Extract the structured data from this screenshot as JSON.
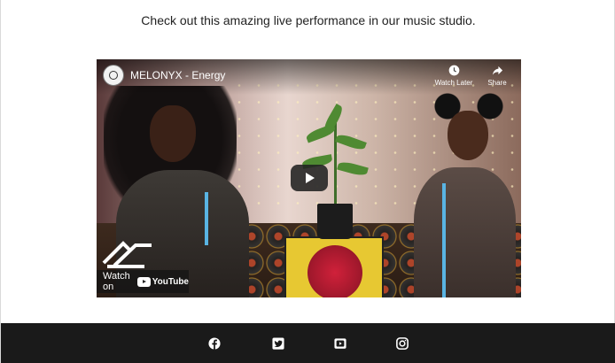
{
  "intro": {
    "text": "Check out this amazing live performance in our music studio."
  },
  "video": {
    "channel": "MELONYX",
    "title": "MELONYX - Energy",
    "actions": [
      {
        "label": "Watch Later",
        "icon": "clock-icon"
      },
      {
        "label": "Share",
        "icon": "share-icon"
      }
    ],
    "watch_on_label": "Watch on",
    "youtube_label": "YouTube",
    "play_icon": "play-icon"
  },
  "footer": {
    "background": "#1a1a1a",
    "social": [
      {
        "name": "facebook",
        "icon": "facebook-icon"
      },
      {
        "name": "twitter",
        "icon": "twitter-icon"
      },
      {
        "name": "youtube",
        "icon": "youtube-icon"
      },
      {
        "name": "instagram",
        "icon": "instagram-icon"
      }
    ]
  },
  "colors": {
    "page_bg": "#ffffff",
    "text": "#222222",
    "footer_bg": "#1a1a1a",
    "youtube_red": "#ff0000"
  }
}
